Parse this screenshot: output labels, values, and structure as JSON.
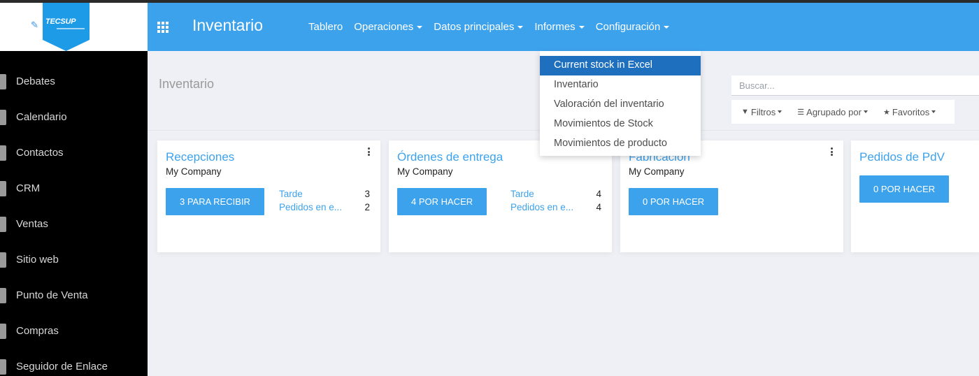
{
  "app": {
    "title": "Inventario"
  },
  "logo": {
    "text": "TECSUP"
  },
  "sidebar": {
    "items": [
      {
        "label": "Debates"
      },
      {
        "label": "Calendario"
      },
      {
        "label": "Contactos"
      },
      {
        "label": "CRM"
      },
      {
        "label": "Ventas"
      },
      {
        "label": "Sitio web"
      },
      {
        "label": "Punto de Venta"
      },
      {
        "label": "Compras"
      },
      {
        "label": "Seguidor de Enlace"
      }
    ]
  },
  "nav": {
    "items": [
      {
        "label": "Tablero"
      },
      {
        "label": "Operaciones"
      },
      {
        "label": "Datos principales"
      },
      {
        "label": "Informes"
      },
      {
        "label": "Configuración"
      }
    ]
  },
  "dropdown": {
    "items": [
      {
        "label": "Current stock in Excel",
        "active": true
      },
      {
        "label": "Inventario"
      },
      {
        "label": "Valoración del inventario"
      },
      {
        "label": "Movimientos de Stock"
      },
      {
        "label": "Movimientos de producto"
      }
    ]
  },
  "control": {
    "breadcrumb": "Inventario",
    "search_placeholder": "Buscar...",
    "filters_label": "Filtros",
    "groupby_label": "Agrupado por",
    "favorites_label": "Favoritos"
  },
  "cards": [
    {
      "title": "Recepciones",
      "company": "My Company",
      "button": "3 PARA RECIBIR",
      "stats": [
        {
          "label": "Tarde",
          "value": "3"
        },
        {
          "label": "Pedidos en e...",
          "value": "2"
        }
      ]
    },
    {
      "title": "Órdenes de entrega",
      "company": "My Company",
      "button": "4 POR HACER",
      "stats": [
        {
          "label": "Tarde",
          "value": "4"
        },
        {
          "label": "Pedidos en e...",
          "value": "4"
        }
      ]
    },
    {
      "title": "Fabricación",
      "company": "My Company",
      "button": "0 POR HACER",
      "stats": []
    },
    {
      "title": "Pedidos de PdV",
      "company": "",
      "button": "0 POR HACER",
      "stats": []
    }
  ],
  "colors": {
    "primary": "#3da2ec",
    "active_item": "#1e6fbe",
    "sidebar": "#000000"
  }
}
